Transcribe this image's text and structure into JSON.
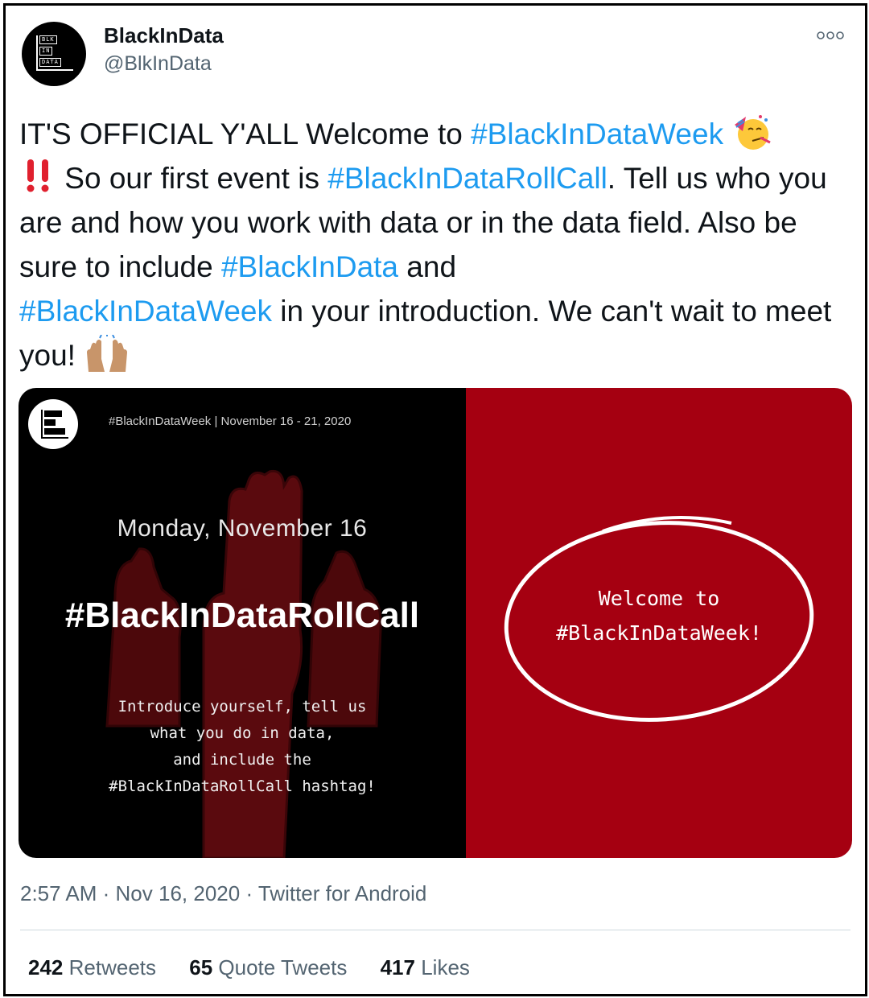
{
  "author": {
    "name": "BlackInData",
    "handle": "@BlkInData",
    "avatar_text": [
      "BLK",
      "IN",
      "DATA"
    ]
  },
  "tweet": {
    "part1": "IT'S OFFICIAL Y'ALL Welcome to ",
    "tag1": "#BlackInDataWeek",
    "emoji1": "party-face-emoji",
    "emoji2": "double-exclamation-emoji",
    "part2": " So our first event is ",
    "tag2": "#BlackInDataRollCall",
    "part3": ". Tell us who you are and how you work with data or in the data field. Also be sure to include ",
    "tag3": "#BlackInData",
    "part4": " and ",
    "tag4": "#BlackInDataWeek",
    "part5": " in your introduction. We can't wait to meet you! ",
    "emoji3": "raising-hands-emoji"
  },
  "image": {
    "date_line": "#BlackInDataWeek | November 16 - 21, 2020",
    "day": "Monday, November 16",
    "hashtag": "#BlackInDataRollCall",
    "intro_lines": [
      "Introduce yourself, tell us",
      "what you do in data,",
      "and include the",
      "#BlackInDataRollCall hashtag!"
    ],
    "welcome_lines": [
      "Welcome to",
      "#BlackInDataWeek!"
    ],
    "colors": {
      "left_bg": "#000000",
      "right_bg": "#a50011",
      "hand_red": "#5a0a0e"
    }
  },
  "meta": {
    "time": "2:57 AM",
    "date": "Nov 16, 2020",
    "source": "Twitter for Android"
  },
  "stats": {
    "retweets_count": "242",
    "retweets_label": "Retweets",
    "quotes_count": "65",
    "quotes_label": "Quote Tweets",
    "likes_count": "417",
    "likes_label": "Likes"
  },
  "icons": {
    "more": "more-horizontal-icon"
  },
  "colors": {
    "link": "#1d9bf0",
    "text": "#0f1419",
    "secondary": "#536471"
  }
}
